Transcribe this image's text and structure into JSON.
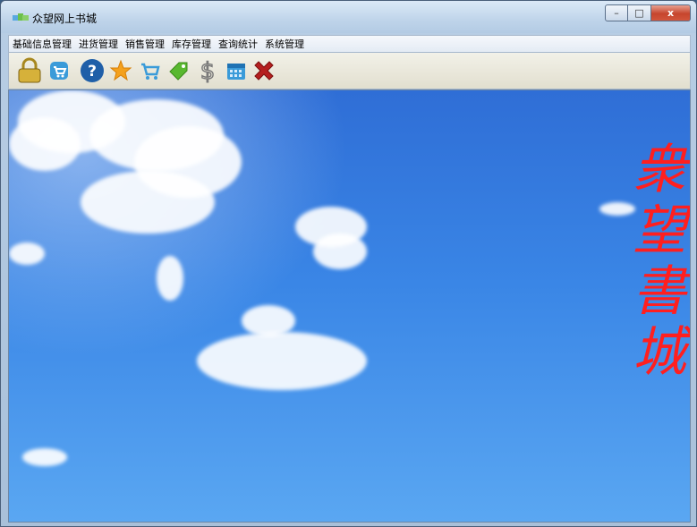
{
  "window": {
    "title": "众望网上书城",
    "controls": {
      "minimize": "–",
      "maximize": "□",
      "close": "x"
    }
  },
  "menu": {
    "items": [
      "基础信息管理",
      "进货管理",
      "销售管理",
      "库存管理",
      "查询统计",
      "系统管理"
    ]
  },
  "toolbar": {
    "buttons": [
      {
        "name": "lock-icon",
        "color": "#d6b13a"
      },
      {
        "name": "cart-badge-icon",
        "color": "#3a9bd9"
      },
      {
        "name": "help-icon",
        "color": "#1f5fa8"
      },
      {
        "name": "star-icon",
        "color": "#f4a11d"
      },
      {
        "name": "shopping-cart-icon",
        "color": "#3a9bd9"
      },
      {
        "name": "tag-icon",
        "color": "#59b82f"
      },
      {
        "name": "dollar-icon",
        "color": "#7a7a7a"
      },
      {
        "name": "calendar-icon",
        "color": "#3a9bd9"
      },
      {
        "name": "exit-icon",
        "color": "#b51f1f"
      }
    ]
  },
  "main": {
    "brand_text": "衆望書城",
    "brand_color": "#ff1f1f"
  }
}
